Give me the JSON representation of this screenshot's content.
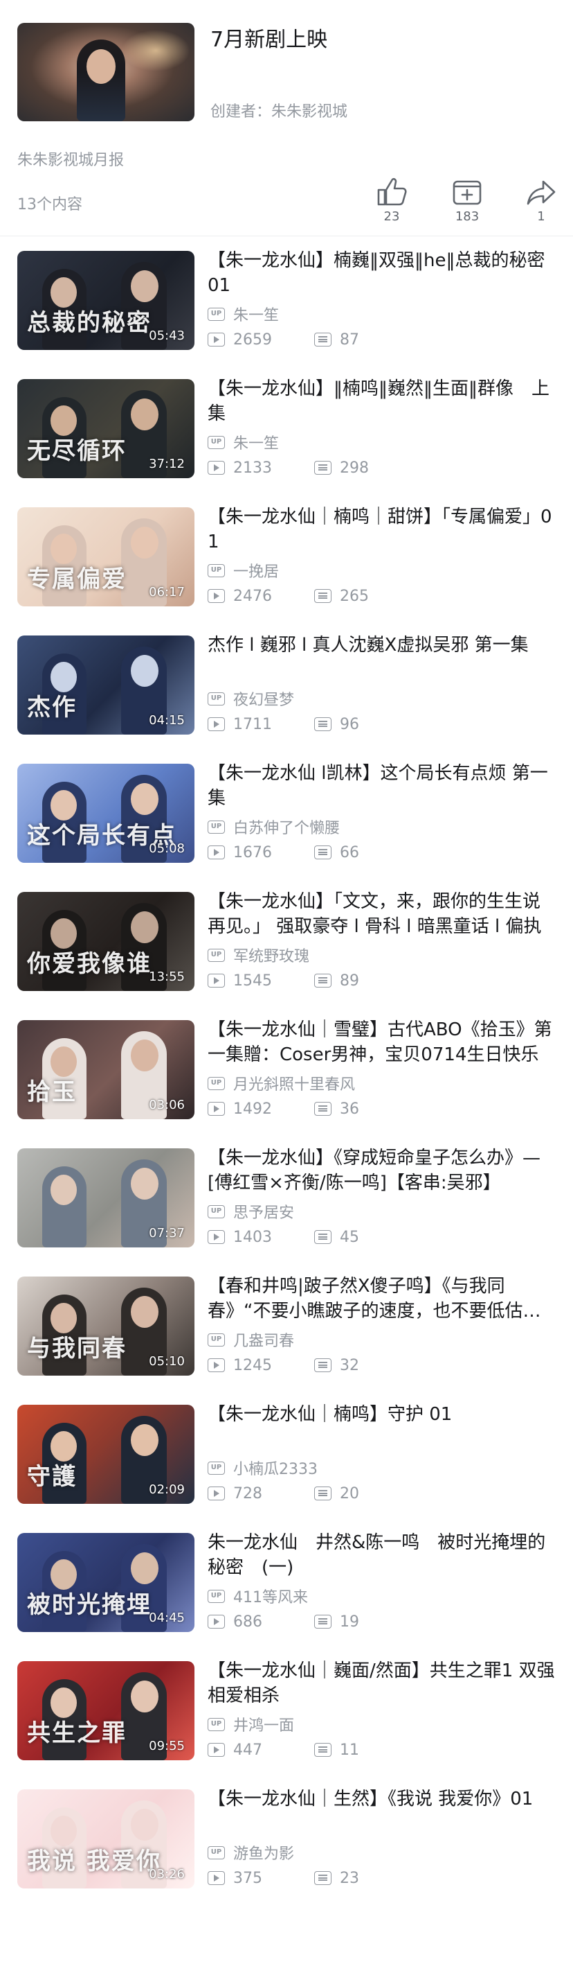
{
  "header": {
    "title": "7月新剧上映",
    "creator": "创建者：朱朱影视城",
    "monthly": "朱朱影视城月报",
    "count": "13个内容",
    "like_count": "23",
    "fav_count": "183",
    "share_count": "1"
  },
  "icons": {
    "like": "thumbs-up-icon",
    "favorite": "add-favorite-icon",
    "share": "share-icon",
    "up": "up-badge-icon",
    "plays": "play-count-icon",
    "danmaku": "danmaku-count-icon"
  },
  "colors": {
    "text": "#18191c",
    "secondary": "#9499a0",
    "divider": "#eceef0"
  },
  "videos": [
    {
      "title": "【朱一龙水仙】楠巍‖双强‖he‖总裁的秘密 01",
      "up": "朱一笙",
      "plays": "2659",
      "danmaku": "87",
      "duration": "05:43",
      "art": "总裁的秘密",
      "bg": "linear-gradient(135deg,#2e3442,#1c2029 60%,#3a3d46)",
      "skin": "#d2b5a2",
      "cloth": "#1e2027"
    },
    {
      "title": "【朱一龙水仙】‖楠鸣‖巍然‖生面‖群像　上集",
      "up": "朱一笙",
      "plays": "2133",
      "danmaku": "298",
      "duration": "37:12",
      "art": "无尽循环",
      "bg": "linear-gradient(135deg,#2b3136,#45433a 55%,#1f2428)",
      "skin": "#cfae95",
      "cloth": "#22272b"
    },
    {
      "title": "【朱一龙水仙｜楠鸣｜甜饼】「专属偏爱」01",
      "up": "一挽居",
      "plays": "2476",
      "danmaku": "265",
      "duration": "06:17",
      "art": "专属偏爱",
      "bg": "linear-gradient(135deg,#f2e3d6,#e9cfbd 55%,#c7a08a)",
      "skin": "#e6c6b2",
      "cloth": "#d8c2b5"
    },
    {
      "title": "杰作 l 巍邪 l 真人沈巍X虚拟吴邪 第一集",
      "up": "夜幻昼梦",
      "plays": "1711",
      "danmaku": "96",
      "duration": "04:15",
      "art": "杰作",
      "bg": "linear-gradient(135deg,#3c4f77,#1f2a45 55%,#6b7fa6)",
      "skin": "#c9d3e6",
      "cloth": "#233052"
    },
    {
      "title": "【朱一龙水仙 l凯林】这个局长有点烦 第一集",
      "up": "白苏伸了个懒腰",
      "plays": "1676",
      "danmaku": "66",
      "duration": "05:08",
      "art": "这个局长有点",
      "bg": "linear-gradient(135deg,#9fb6e8,#5f7fc7 55%,#3d4f8a)",
      "skin": "#e2c4b0",
      "cloth": "#2b3a66"
    },
    {
      "title": "【朱一龙水仙】「文文，来，跟你的生生说再见。」 强取豪夺 l 骨科 l 暗黑童话 l 偏执",
      "up": "军统野玫瑰",
      "plays": "1545",
      "danmaku": "89",
      "duration": "13:55",
      "art": "你爱我像谁",
      "bg": "linear-gradient(135deg,#3a3533,#241f1d 55%,#55504b)",
      "skin": "#bfa593",
      "cloth": "#1c1a19"
    },
    {
      "title": "【朱一龙水仙｜雪璧】古代ABO《拾玉》第一集贈：Coser男神，宝贝0714生日快乐",
      "up": "月光斜照十里春风",
      "plays": "1492",
      "danmaku": "36",
      "duration": "03:06",
      "art": "拾玉",
      "bg": "linear-gradient(135deg,#4a3a3c,#7a5a55 55%,#2e2628)",
      "skin": "#d9b7a3",
      "cloth": "#e8e0dc"
    },
    {
      "title": "【朱一龙水仙】《穿成短命皇子怎么办》—[傅红雪×齐衡/陈一鸣]【客串:吴邪】",
      "up": "思予居安",
      "plays": "1403",
      "danmaku": "45",
      "duration": "07:37",
      "art": "",
      "bg": "linear-gradient(135deg,#b8b9b6,#8e8f8a 55%,#c9b9ae)",
      "skin": "#e0c8b8",
      "cloth": "#6e7a8a"
    },
    {
      "title": "【春和井鸣|跛子然X傻子鸣】《与我同春》“不要小瞧跛子的速度，也不要低估傻子的痴情”",
      "up": "几盎司春",
      "plays": "1245",
      "danmaku": "32",
      "duration": "05:10",
      "art": "与我同春",
      "bg": "linear-gradient(135deg,#d9d2cc,#8c7f78 55%,#3b3633)",
      "skin": "#d7b8a5",
      "cloth": "#2f2b29"
    },
    {
      "title": "【朱一龙水仙｜楠鸣】守护 01",
      "up": "小楠瓜2333",
      "plays": "728",
      "danmaku": "20",
      "duration": "02:09",
      "art": "守護",
      "bg": "linear-gradient(135deg,#c84a2e,#8e3a2e 45%,#243042)",
      "skin": "#e2c0a8",
      "cloth": "#1f2735"
    },
    {
      "title": "朱一龙水仙　井然&陈一鸣　被时光掩埋的秘密　(一)",
      "up": "411等风来",
      "plays": "686",
      "danmaku": "19",
      "duration": "04:45",
      "art": "被时光掩埋",
      "bg": "linear-gradient(135deg,#3d4f8f,#2a3566 55%,#7a89c4)",
      "skin": "#d8bca8",
      "cloth": "#2d3a6e"
    },
    {
      "title": "【朱一龙水仙｜巍面/然面】共生之罪1 双强 相爱相杀",
      "up": "井鸿一面",
      "plays": "447",
      "danmaku": "11",
      "duration": "09:55",
      "art": "共生之罪",
      "bg": "linear-gradient(135deg,#c93a36,#8e1f24 55%,#e05a4f)",
      "skin": "#e3c5b2",
      "cloth": "#2b2b30"
    },
    {
      "title": "【朱一龙水仙｜生然】《我说 我爱你》01",
      "up": "游鱼为影",
      "plays": "375",
      "danmaku": "23",
      "duration": "03:26",
      "art": "我说 我爱你",
      "bg": "linear-gradient(135deg,#fbe9ea,#f6d6d8 55%,#fff2f1)",
      "skin": "#f1d9d6",
      "cloth": "#f3e1df"
    }
  ]
}
